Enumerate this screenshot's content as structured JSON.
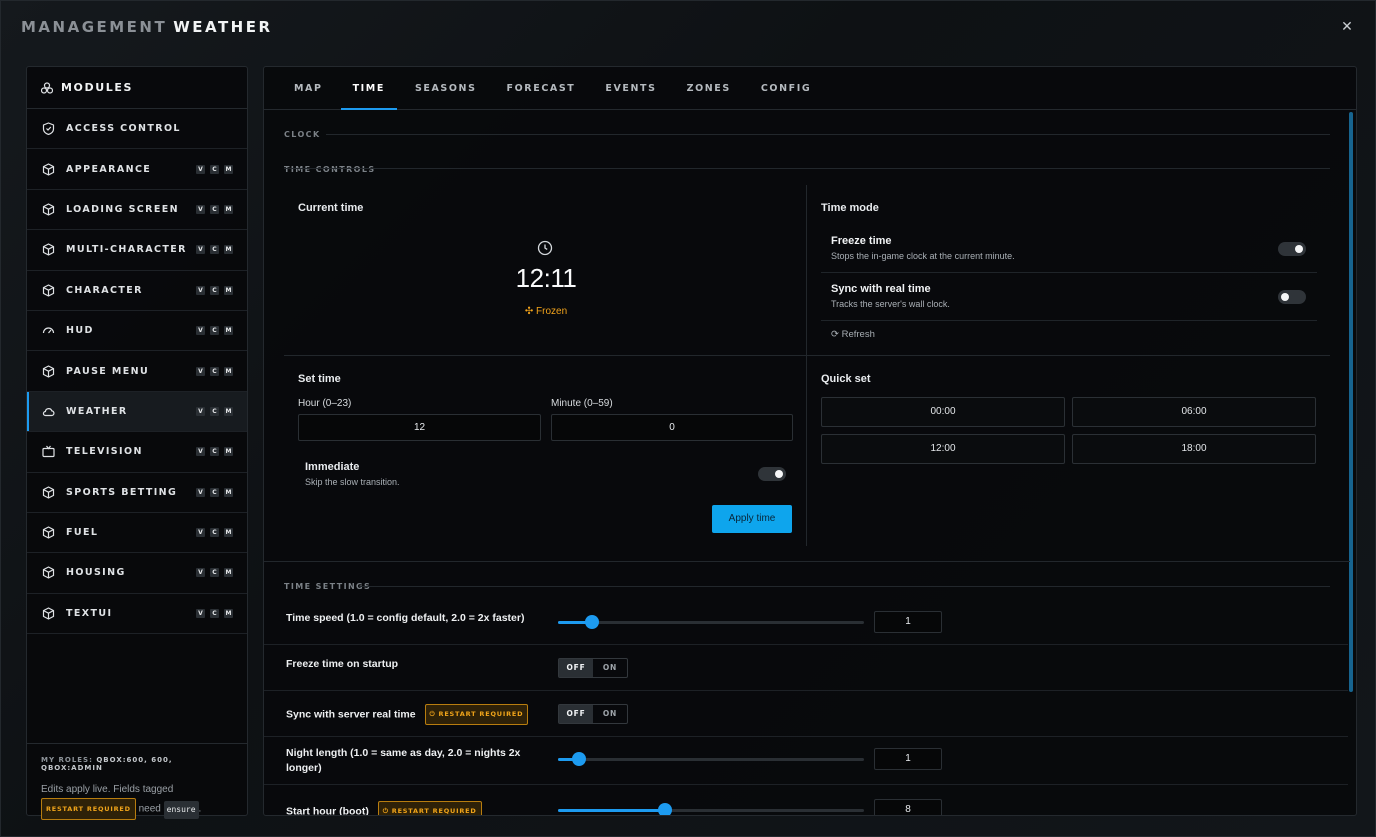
{
  "window": {
    "title_prefix": "MANAGEMENT",
    "title_main": "WEATHER",
    "close_glyph": "✕"
  },
  "sidebar": {
    "header_label": "MODULES",
    "items": [
      {
        "label": "ACCESS CONTROL",
        "icon": "shield-icon",
        "badges": false
      },
      {
        "label": "APPEARANCE",
        "icon": "cube-icon",
        "badges": true
      },
      {
        "label": "LOADING SCREEN",
        "icon": "cube-icon",
        "badges": true
      },
      {
        "label": "MULTI-CHARACTER",
        "icon": "cube-icon",
        "badges": true
      },
      {
        "label": "CHARACTER",
        "icon": "cube-icon",
        "badges": true
      },
      {
        "label": "HUD",
        "icon": "gauge-icon",
        "badges": true
      },
      {
        "label": "PAUSE MENU",
        "icon": "cube-icon",
        "badges": true
      },
      {
        "label": "WEATHER",
        "icon": "cloud-icon",
        "badges": true,
        "active": true
      },
      {
        "label": "TELEVISION",
        "icon": "tv-icon",
        "badges": true
      },
      {
        "label": "SPORTS BETTING",
        "icon": "cube-icon",
        "badges": true
      },
      {
        "label": "FUEL",
        "icon": "cube-icon",
        "badges": true
      },
      {
        "label": "HOUSING",
        "icon": "cube-icon",
        "badges": true
      },
      {
        "label": "TEXTUI",
        "icon": "cube-icon",
        "badges": true
      }
    ],
    "badges": [
      "V",
      "C",
      "M"
    ],
    "footer": {
      "roles_label": "MY ROLES:",
      "roles_value": "QBOX:600, 600, QBOX:ADMIN",
      "edits_text": "Edits apply live. Fields tagged",
      "restart_tag": "RESTART REQUIRED",
      "need_text": "need",
      "ensure_tag": "ensure",
      "period": "."
    }
  },
  "tabs": [
    "MAP",
    "TIME",
    "SEASONS",
    "FORECAST",
    "EVENTS",
    "ZONES",
    "CONFIG"
  ],
  "active_tab": "TIME",
  "clock_section": {
    "title": "CLOCK",
    "controls_title": "TIME CONTROLS",
    "current_time_label": "Current time",
    "current_time_value": "12:11",
    "status": "Frozen",
    "time_mode_label": "Time mode",
    "freeze": {
      "name": "Freeze time",
      "desc": "Stops the in-game clock at the current minute.",
      "on": true
    },
    "sync": {
      "name": "Sync with real time",
      "desc": "Tracks the server's wall clock.",
      "on": false
    },
    "refresh_label": "Refresh",
    "set_time_label": "Set time",
    "hour_label": "Hour (0–23)",
    "hour_value": "12",
    "minute_label": "Minute (0–59)",
    "minute_value": "0",
    "immediate": {
      "name": "Immediate",
      "desc": "Skip the slow transition.",
      "on": true
    },
    "apply_label": "Apply time",
    "quick_set_label": "Quick set",
    "quick_set": [
      "00:00",
      "06:00",
      "12:00",
      "18:00"
    ]
  },
  "settings": {
    "title": "TIME SETTINGS",
    "rows": [
      {
        "label": "Time speed (1.0 = config default, 2.0 = 2x faster)",
        "value": "1"
      },
      {
        "label": "Freeze time on startup",
        "off": "OFF",
        "on": "ON"
      },
      {
        "label": "Sync with server real time",
        "tag": "RESTART REQUIRED",
        "off": "OFF",
        "on": "ON"
      },
      {
        "label": "Night length (1.0 = same as day, 2.0 = nights 2x longer)",
        "value": "1"
      },
      {
        "label": "Start hour (boot)",
        "tag": "RESTART REQUIRED",
        "value": "8"
      }
    ],
    "time_speed_fraction": 0.11,
    "night_length_fraction": 0.07,
    "start_hour_fraction": 0.35
  },
  "colors": {
    "accent": "#1d9bf0",
    "warning": "#f0a41a"
  }
}
